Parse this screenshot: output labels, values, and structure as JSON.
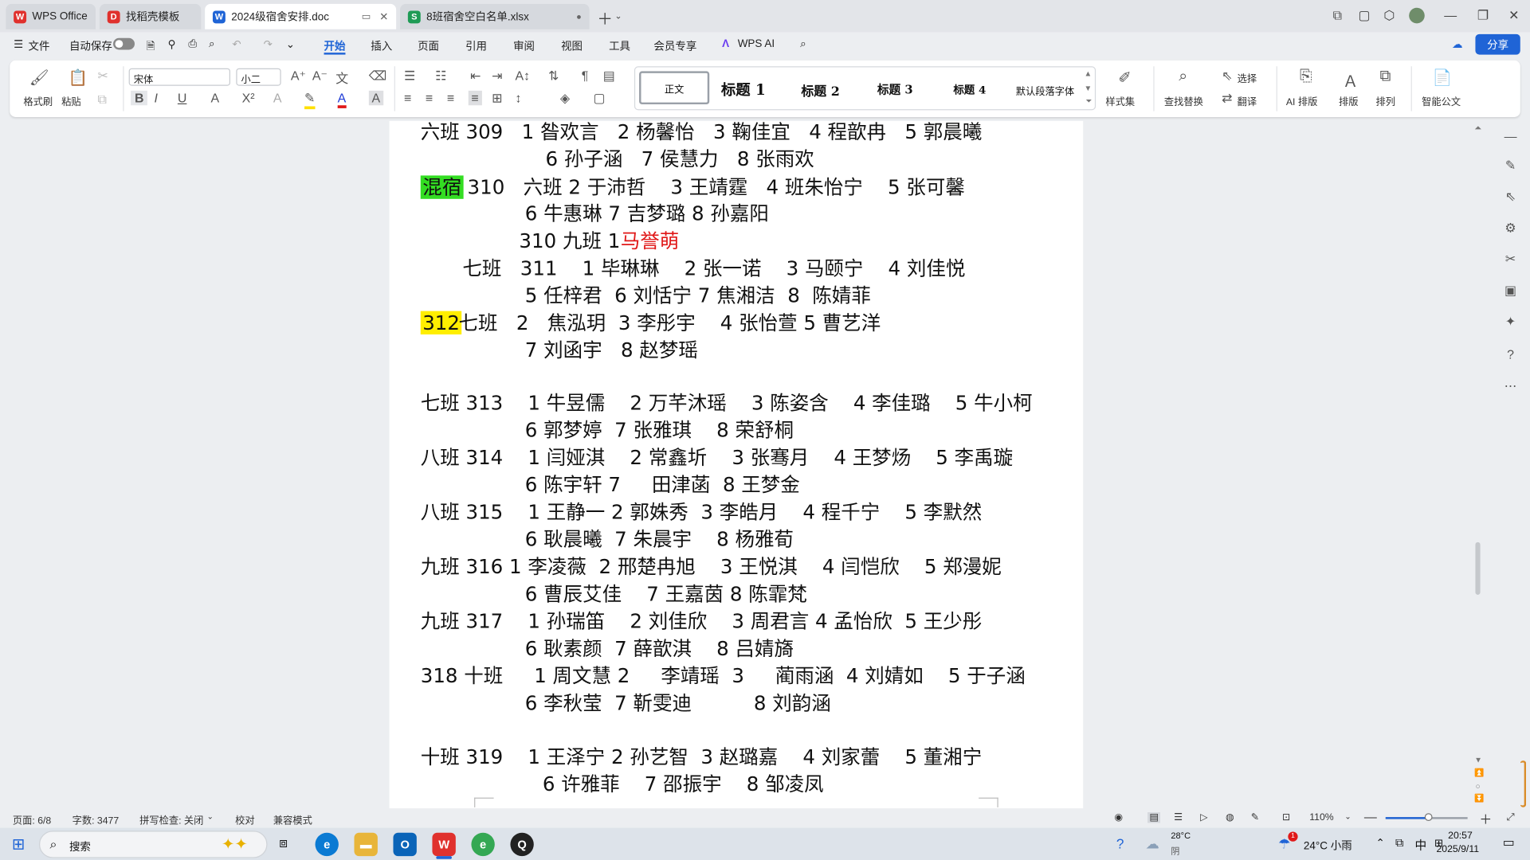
{
  "tabs": [
    {
      "label": "WPS Office",
      "icon": "wps-logo-icon",
      "color": "#e0312d"
    },
    {
      "label": "找稻壳模板",
      "icon": "docer-icon",
      "color": "#e0312d"
    },
    {
      "label": "2024级宿舍安排.doc",
      "icon": "word-doc-icon",
      "color": "#1f64d6"
    },
    {
      "label": "8班宿舍空白名单.xlsx",
      "icon": "excel-sheet-icon",
      "color": "#1e9b55"
    }
  ],
  "menu": {
    "file": "文件",
    "autosave": "自动保存",
    "items": [
      "开始",
      "插入",
      "页面",
      "引用",
      "审阅",
      "视图",
      "工具",
      "会员专享"
    ],
    "active": "开始",
    "wps_ai": "WPS AI",
    "share": "分享"
  },
  "ribbon": {
    "format_painter": "格式刷",
    "paste": "粘贴",
    "font_name": "宋体",
    "font_size": "小二",
    "styles": [
      "正文",
      "标题 1",
      "标题 2",
      "标题 3",
      "标题 4",
      "默认段落字体"
    ],
    "style_set": "样式集",
    "find_replace": "查找替换",
    "select": "选择",
    "translate": "翻译",
    "ai_layout": "AI 排版",
    "layout": "排版",
    "arrange": "排列",
    "smart_doc": "智能公文"
  },
  "document_lines": [
    "六班 309   1 昝欢言   2 杨馨怡   3 鞠佳宜   4 程歆冉   5 郭晨曦",
    "6 孙子涵   7 侯慧力   8 张雨欢",
    "310   六班 2 于沛哲    3 王靖霆   4 班朱怡宁    5 张可馨",
    "6 牛惠琳 7 吉梦璐 8 孙嘉阳",
    "310 九班 1 ",
    "七班   311    1 毕琳琳    2 张一诺    3 马颐宁    4 刘佳悦",
    "5 任梓君  6 刘恬宁 7 焦湘洁  8  陈婧菲",
    "七班   2   焦泓玥  3 李彤宇    4 张怡萱 5 曹艺洋",
    "7 刘函宇   8 赵梦瑶",
    "七班 313    1 牛昱儒    2 万芊沐瑶    3 陈姿含    4 李佳璐    5 牛小柯",
    "6 郭梦婷  7 张雅琪    8 荣舒桐",
    "八班 314    1 闫娅淇    2 常鑫圻    3 张骞月    4 王梦炀    5 李禹璇",
    "6 陈宇轩 7     田津菡  8 王梦金",
    "八班 315    1 王静一 2 郭姝秀  3 李皓月    4 程千宁    5 李默然",
    "6 耿晨曦  7 朱晨宇    8 杨雅荀",
    "九班 316 1 李凌薇  2 邢楚冉旭    3 王悦淇    4 闫恺欣    5 郑漫妮",
    "6 曹辰艾佳    7 王嘉茵 8 陈霏梵",
    "九班 317    1 孙瑞笛    2 刘佳欣    3 周君言 4 孟怡欣  5 王少彤",
    "6 耿素颜  7 薛歆淇    8 吕婧旖",
    "318 十班     1 周文慧 2     李靖瑶  3     蔺雨涵  4 刘婧如    5 于子涵",
    "6 李秋莹  7 靳雯迪          8 刘韵涵",
    "十班 319    1 王泽宁 2 孙艺智  3 赵璐嘉    4 刘家蕾    5 董湘宁",
    "6 许雅菲    7 邵振宇    8 邹凌凤"
  ],
  "highlights": {
    "green_label": "混宿",
    "yellow_label": "312",
    "red_name": "马誉萌"
  },
  "highlight_colors": {
    "green": "#33dd22",
    "yellow": "#ffee00",
    "red": "#e01818"
  },
  "status": {
    "page": "页面: 6/8",
    "words": "字数: 3477",
    "spell": "拼写检查: 关闭",
    "proof": "校对",
    "compat": "兼容模式",
    "zoom": "110%",
    "zoom_fraction": 0.52
  },
  "taskbar": {
    "search": "搜索",
    "weather_temp": "28°C",
    "weather_desc": "阴",
    "weather2": "24°C 小雨",
    "ime": "中",
    "time": "20:57",
    "date": "2025/9/11",
    "notif_badge": "1"
  }
}
